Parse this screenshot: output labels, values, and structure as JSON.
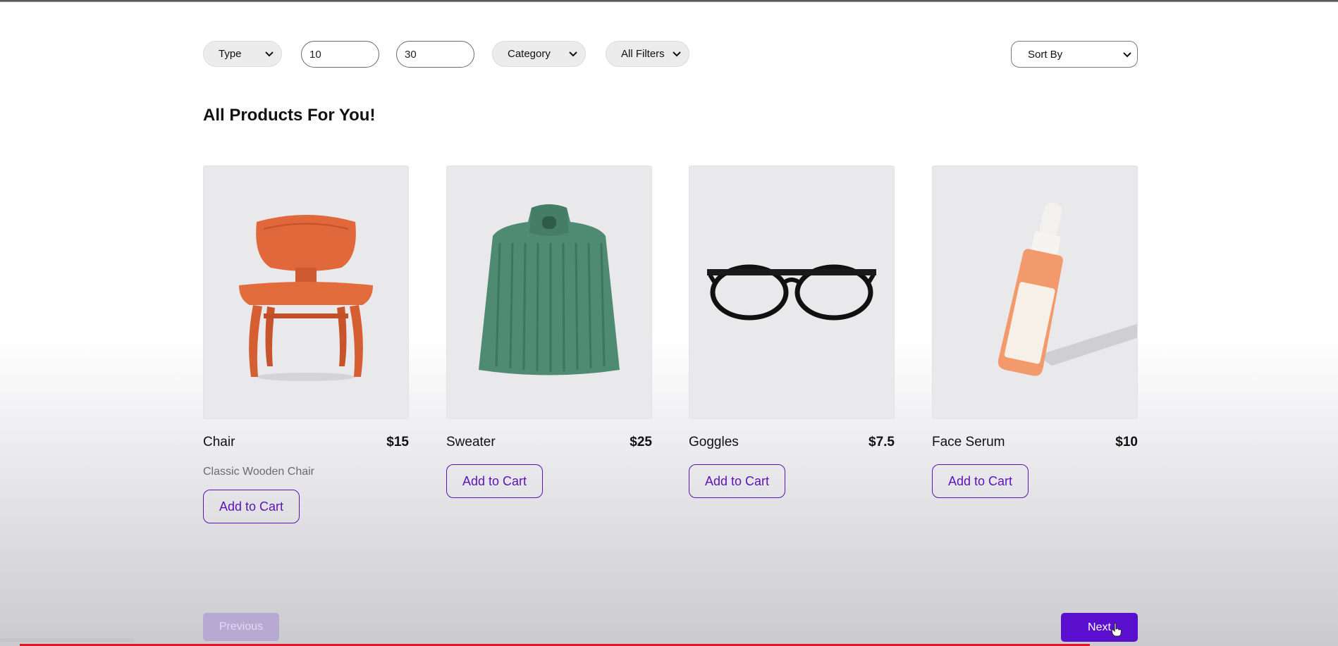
{
  "filters": {
    "type_label": "Type",
    "min_value": "10",
    "max_value": "30",
    "category_label": "Category",
    "all_filters_label": "All Filters",
    "sort_label": "Sort By"
  },
  "heading": "All Products For You!",
  "products": [
    {
      "name": "Chair",
      "price": "$15",
      "description": "Classic Wooden Chair",
      "button": "Add to Cart",
      "image_icon": "chair-image"
    },
    {
      "name": "Sweater",
      "price": "$25",
      "description": "",
      "button": "Add to Cart",
      "image_icon": "sweater-image"
    },
    {
      "name": "Goggles",
      "price": "$7.5",
      "description": "",
      "button": "Add to Cart",
      "image_icon": "glasses-image"
    },
    {
      "name": "Face Serum",
      "price": "$10",
      "description": "",
      "button": "Add to Cart",
      "image_icon": "serum-bottle-image"
    }
  ],
  "pagination": {
    "previous_label": "Previous",
    "next_label": "Next",
    "previous_disabled": true
  },
  "colors": {
    "accent": "#5a0fcf",
    "accent_disabled": "#b7a9d2",
    "progress": "#e01a1a"
  }
}
